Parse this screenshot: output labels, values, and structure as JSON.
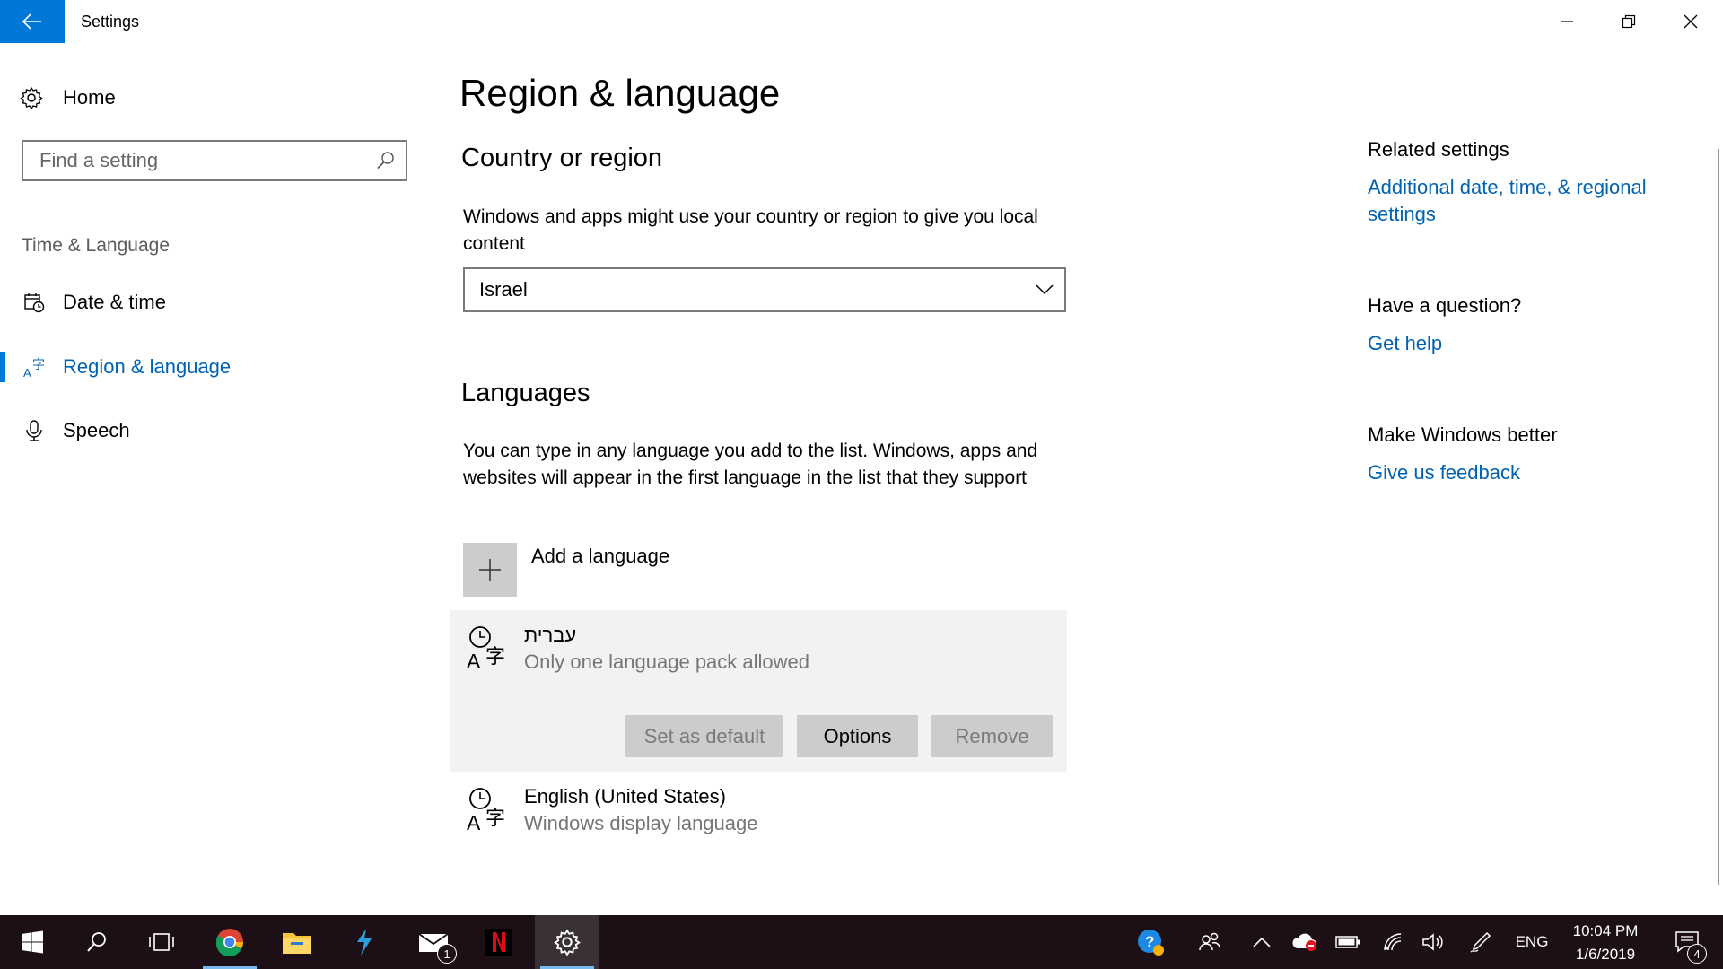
{
  "window": {
    "title": "Settings"
  },
  "nav": {
    "home_label": "Home",
    "search_placeholder": "Find a setting",
    "section_label": "Time & Language",
    "items": [
      {
        "label": "Date & time",
        "icon": "calendar-clock-icon",
        "selected": false
      },
      {
        "label": "Region & language",
        "icon": "region-language-icon",
        "selected": true
      },
      {
        "label": "Speech",
        "icon": "microphone-icon",
        "selected": false
      }
    ]
  },
  "main": {
    "title": "Region & language",
    "country": {
      "heading": "Country or region",
      "description": "Windows and apps might use your country or region to give you local content",
      "selected_value": "Israel"
    },
    "languages": {
      "heading": "Languages",
      "description": "You can type in any language you add to the list. Windows, apps and websites will appear in the first language in the list that they support",
      "add_label": "Add a language",
      "items": [
        {
          "name": "עברית",
          "subtitle": "Only one language pack allowed",
          "expanded": true
        },
        {
          "name": "English (United States)",
          "subtitle": "Windows display language",
          "expanded": false
        }
      ],
      "buttons": {
        "set_default": "Set as default",
        "options": "Options",
        "remove": "Remove"
      }
    }
  },
  "related": {
    "heading": "Related settings",
    "link": "Additional date, time, & regional settings",
    "question_heading": "Have a question?",
    "help_link": "Get help",
    "better_heading": "Make Windows better",
    "feedback_link": "Give us feedback"
  },
  "taskbar": {
    "language": "ENG",
    "time": "10:04 PM",
    "date": "1/6/2019",
    "mail_badge": "1",
    "notifications_badge": "4"
  },
  "colors": {
    "accent": "#0078d7",
    "link": "#0063b1",
    "taskbar_bg": "#1c1016"
  }
}
